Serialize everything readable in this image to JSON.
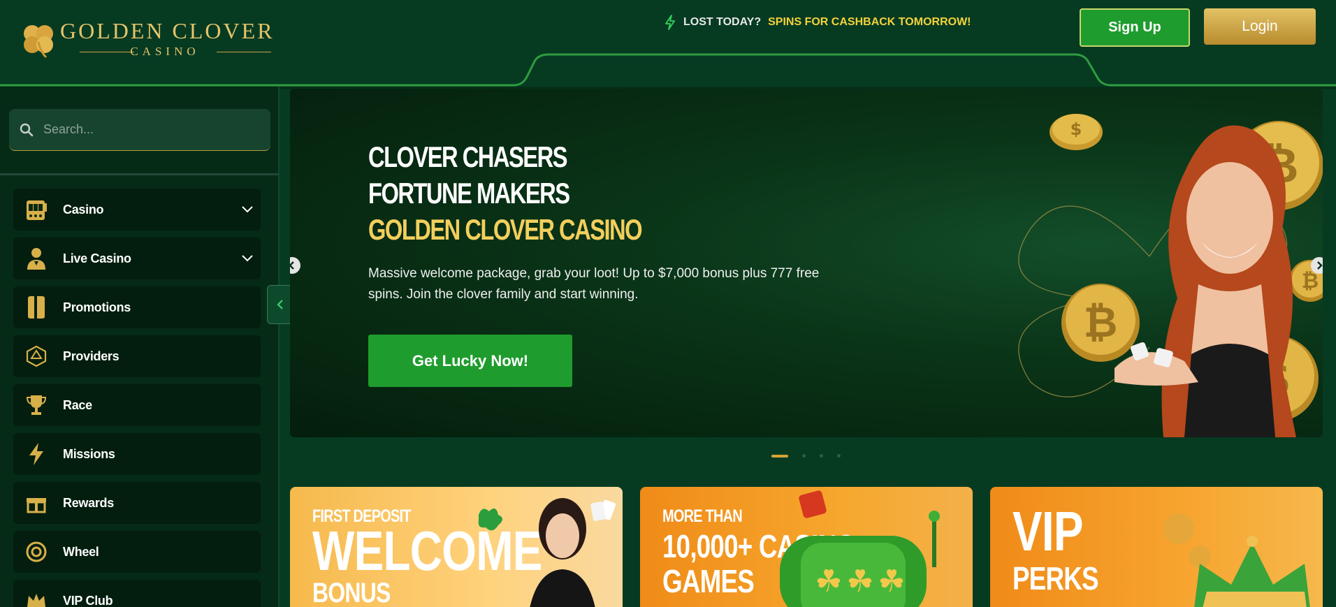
{
  "header": {
    "logo_title": "GOLDEN CLOVER",
    "logo_subtitle": "CASINO",
    "promo_lost": "LOST TODAY?",
    "promo_spins": "SPINS FOR CASHBACK TOMORROW!",
    "signup_label": "Sign Up",
    "login_label": "Login"
  },
  "sidebar": {
    "search_placeholder": "Search...",
    "items": [
      {
        "label": "Casino",
        "icon": "slot-machine-icon",
        "expandable": true
      },
      {
        "label": "Live Casino",
        "icon": "dealer-icon",
        "expandable": true
      },
      {
        "label": "Promotions",
        "icon": "promotions-icon",
        "expandable": false
      },
      {
        "label": "Providers",
        "icon": "dice-icon",
        "expandable": false
      },
      {
        "label": "Race",
        "icon": "trophy-icon",
        "expandable": false
      },
      {
        "label": "Missions",
        "icon": "bolt-icon",
        "expandable": false
      },
      {
        "label": "Rewards",
        "icon": "gift-icon",
        "expandable": false
      },
      {
        "label": "Wheel",
        "icon": "wheel-icon",
        "expandable": false
      },
      {
        "label": "VIP Club",
        "icon": "crown-icon",
        "expandable": false
      }
    ]
  },
  "hero": {
    "line1": "CLOVER CHASERS",
    "line2": "FORTUNE MAKERS",
    "line3": "GOLDEN CLOVER CASINO",
    "text": "Massive welcome package, grab your loot! Up to $7,000 bonus plus 777 free spins. Join the clover family and start winning.",
    "cta_label": "Get Lucky Now!"
  },
  "cards": [
    {
      "small": "FIRST DEPOSIT",
      "big": "WELCOME",
      "extra": "BONUS"
    },
    {
      "small": "MORE THAN",
      "big": "10,000+ CASINO",
      "extra": "GAMES"
    },
    {
      "small": "",
      "big": "VIP",
      "extra": "PERKS"
    }
  ],
  "colors": {
    "background": "#063b22",
    "accent_green": "#1f9c2e",
    "gold": "#e6c36a",
    "promo_yellow": "#f5d23a"
  }
}
